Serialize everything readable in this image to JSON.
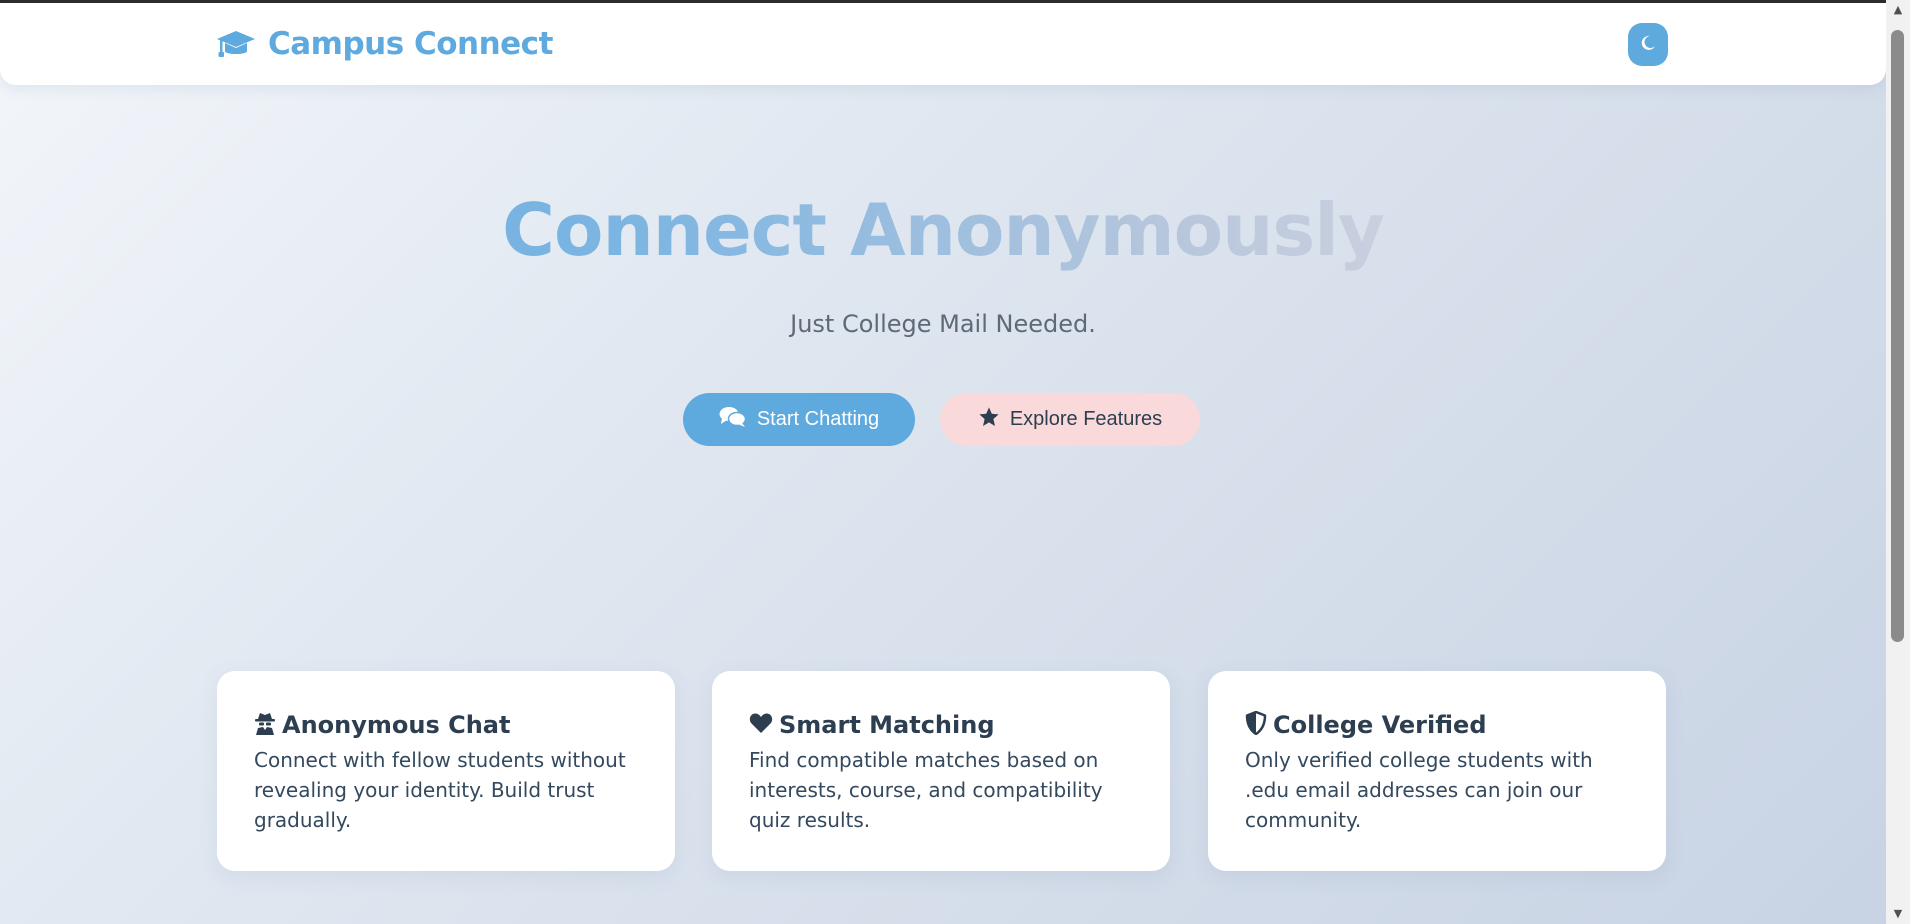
{
  "header": {
    "brand_title": "Campus Connect",
    "brand_icon": "graduation-cap-icon",
    "theme_toggle_icon": "moon-icon"
  },
  "hero": {
    "title": "Connect Anonymously",
    "subtitle": "Just College Mail Needed.",
    "primary_button": {
      "label": "Start Chatting",
      "icon": "comments-icon"
    },
    "secondary_button": {
      "label": "Explore Features",
      "icon": "star-icon"
    }
  },
  "features": [
    {
      "title": "Anonymous Chat",
      "icon": "user-secret-icon",
      "description": "Connect with fellow students without revealing your identity. Build trust gradually."
    },
    {
      "title": "Smart Matching",
      "icon": "heart-icon",
      "description": "Find compatible matches based on interests, course, and compatibility quiz results."
    },
    {
      "title": "College Verified",
      "icon": "shield-icon",
      "description": "Only verified college students with .edu email addresses can join our community."
    }
  ],
  "colors": {
    "primary": "#5ea9de",
    "secondary_button_bg": "#f9d9d9",
    "text_dark": "#2c3e50",
    "text_muted": "#5e6a78",
    "card_bg": "#ffffff"
  }
}
